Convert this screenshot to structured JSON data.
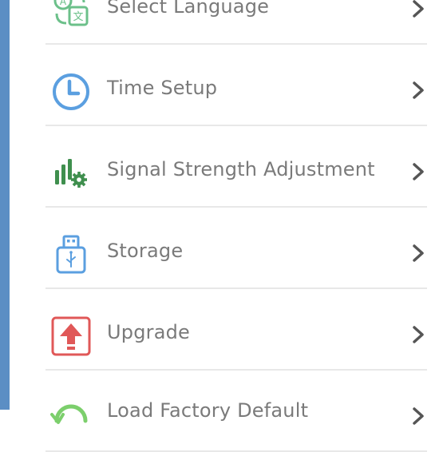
{
  "colors": {
    "rail": "#5b8ec4",
    "label": "#7a7a7a",
    "chevron": "#555555",
    "divider": "#e8e8e8",
    "language_icon": "#6cc08a",
    "time_icon": "#5b9fe0",
    "signal_icon": "#3f8f4e",
    "storage_icon": "#5b9fe0",
    "upgrade_icon": "#e05858",
    "reset_icon": "#7ccf6c"
  },
  "menu": {
    "items": [
      {
        "label": "Select Language",
        "icon": "translate-icon"
      },
      {
        "label": "Time Setup",
        "icon": "clock-icon"
      },
      {
        "label": "Signal Strength Adjustment",
        "icon": "signal-settings-icon"
      },
      {
        "label": "Storage",
        "icon": "usb-drive-icon"
      },
      {
        "label": "Upgrade",
        "icon": "upgrade-arrow-icon"
      },
      {
        "label": "Load Factory Default",
        "icon": "reset-icon"
      }
    ]
  }
}
